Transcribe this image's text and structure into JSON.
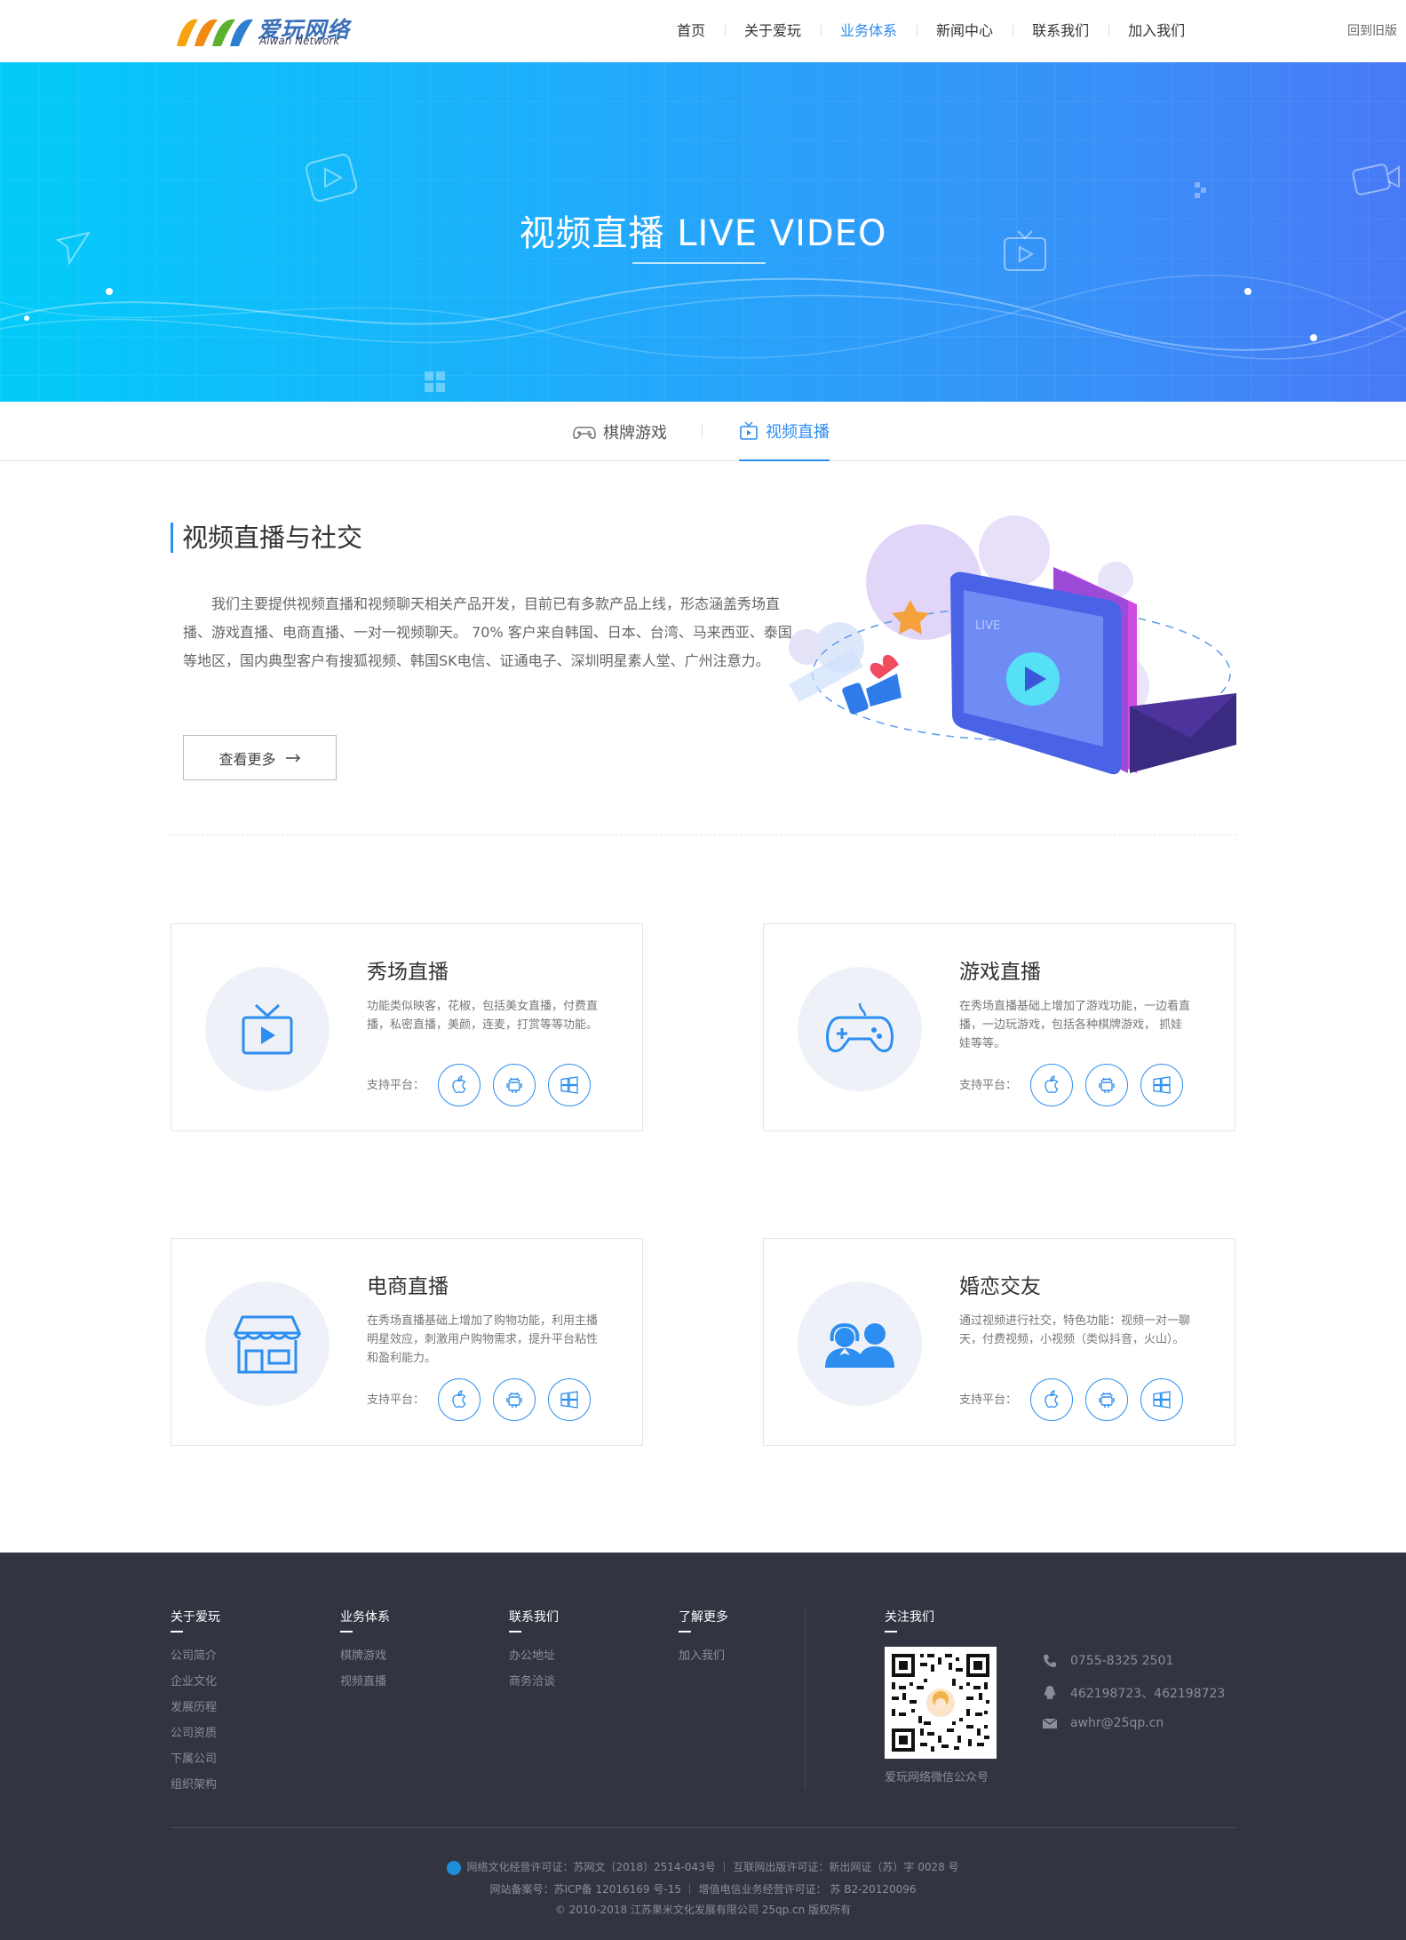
{
  "header": {
    "logo_cn": "爱玩网络",
    "logo_en": "Aiwan Network",
    "nav": [
      {
        "label": "首页",
        "active": false
      },
      {
        "label": "关于爱玩",
        "active": false
      },
      {
        "label": "业务体系",
        "active": true
      },
      {
        "label": "新闻中心",
        "active": false
      },
      {
        "label": "联系我们",
        "active": false
      },
      {
        "label": "加入我们",
        "active": false
      }
    ],
    "old_version": "回到旧版"
  },
  "banner": {
    "title": "视频直播  LIVE VIDEO"
  },
  "subtabs": [
    {
      "label": "棋牌游戏",
      "icon": "gamepad-icon",
      "active": false
    },
    {
      "label": "视频直播",
      "icon": "tv-icon",
      "active": true
    }
  ],
  "intro": {
    "title": "视频直播与社交",
    "text": "我们主要提供视频直播和视频聊天相关产品开发，目前已有多款产品上线，形态涵盖秀场直播、游戏直播、电商直播、一对一视频聊天。 70% 客户来自韩国、日本、台湾、马来西亚、泰国等地区，国内典型客户有搜狐视频、韩国SK电信、证通电子、深圳明星素人堂、广州注意力。",
    "more_label": "查看更多",
    "illus_badge": "LIVE"
  },
  "cards": [
    {
      "title": "秀场直播",
      "desc": "功能类似映客，花椒，包括美女直播，付费直播，私密直播，美颜，连麦，打赏等等功能。",
      "icon": "tv-play-icon",
      "platform_label": "支持平台："
    },
    {
      "title": "游戏直播",
      "desc": "在秀场直播基础上增加了游戏功能，一边看直播，一边玩游戏，包括各种棋牌游戏， 抓娃娃等等。",
      "icon": "gamepad-icon",
      "platform_label": "支持平台："
    },
    {
      "title": "电商直播",
      "desc": "在秀场直播基础上增加了购物功能，利用主播明星效应，刺激用户购物需求，提升平台粘性和盈利能力。",
      "icon": "store-icon",
      "platform_label": "支持平台："
    },
    {
      "title": "婚恋交友",
      "desc": "通过视频进行社交，特色功能：视频一对一聊天，付费视频，小视频（类似抖音，火山）。",
      "icon": "couple-icon",
      "platform_label": "支持平台："
    }
  ],
  "footer": {
    "columns": [
      {
        "title": "关于爱玩",
        "links": [
          "公司简介",
          "企业文化",
          "发展历程",
          "公司资质",
          "下属公司",
          "组织架构"
        ]
      },
      {
        "title": "业务体系",
        "links": [
          "棋牌游戏",
          "视频直播"
        ]
      },
      {
        "title": "联系我们",
        "links": [
          "办公地址",
          "商务洽谈"
        ]
      },
      {
        "title": "了解更多",
        "links": [
          "加入我们"
        ]
      }
    ],
    "follow_title": "关注我们",
    "qr_caption": "爱玩网络微信公众号",
    "phone": "0755-8325 2501",
    "qq": "462198723、462198723",
    "email": "awhr@25qp.cn",
    "legal_1": "网络文化经营许可证：苏网文〔2018〕2514-043号  ｜  互联网出版许可证：新出网证（苏）字 0028 号",
    "legal_2": "网站备案号：苏ICP备 12016169 号-15  ｜  增值电信业务经营许可证： 苏 B2-20120096",
    "legal_3": "© 2010-2018 江苏果米文化发展有限公司 25qp.cn 版权所有"
  },
  "colors": {
    "accent": "#2c8ef0",
    "footer_bg": "#323441",
    "banner_start": "#03cbf9",
    "banner_end": "#4879f5"
  }
}
